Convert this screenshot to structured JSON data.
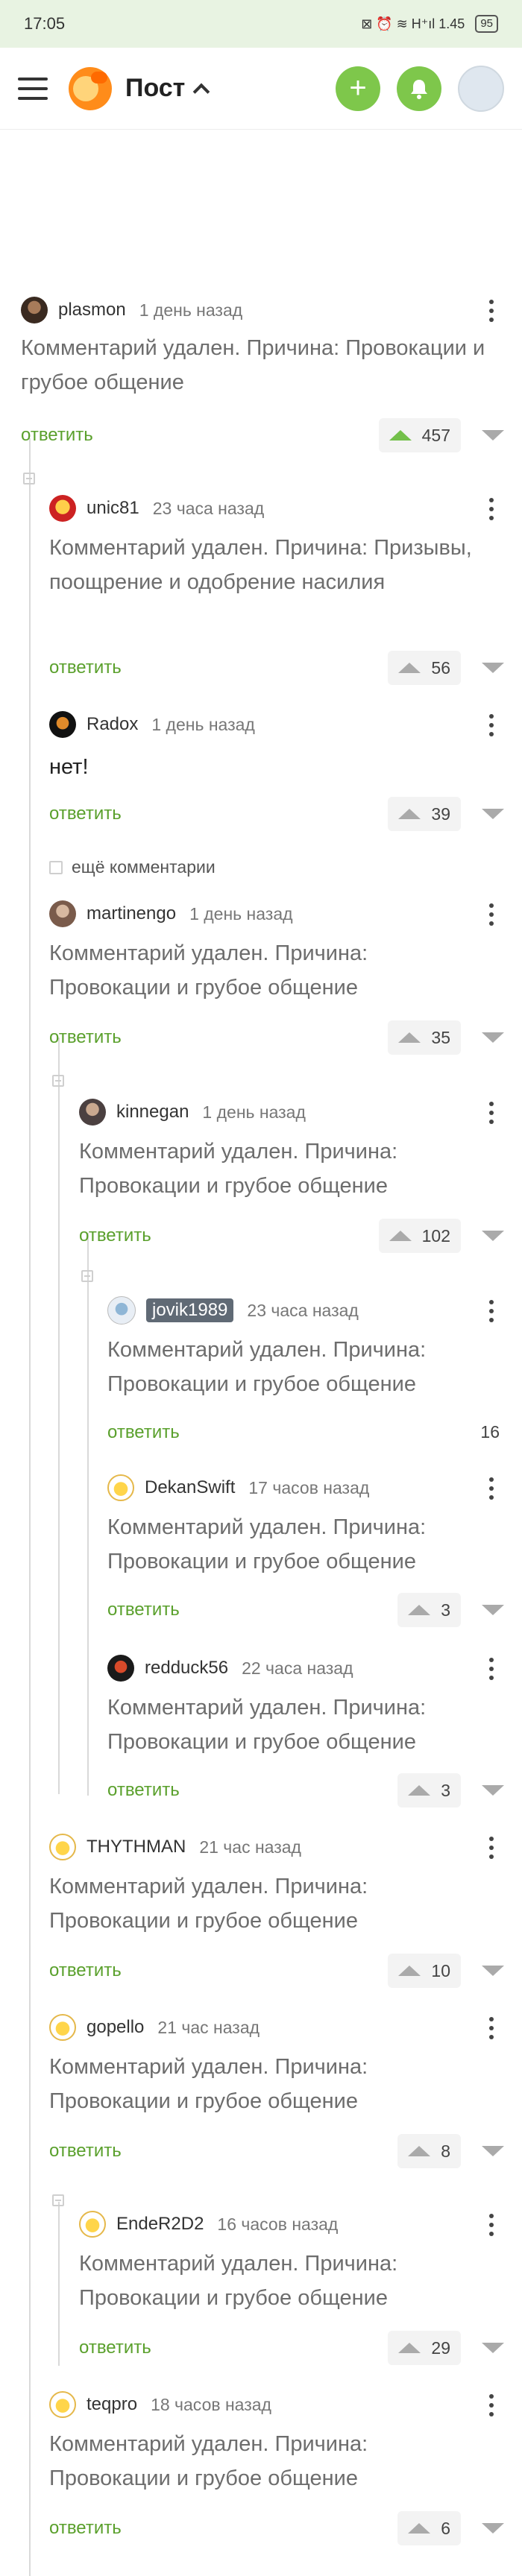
{
  "status": {
    "time": "17:05",
    "icons": "⊠ ⏰ ≋ H⁺ıl 1.45",
    "battery": "95"
  },
  "header": {
    "title": "Пост"
  },
  "comments": [
    {
      "user": "plasmon",
      "when": "1 день назад",
      "text": "Комментарий удален. Причина: Провокации и грубое общение",
      "reply": "ответить",
      "votes": "457"
    },
    {
      "user": "unic81",
      "when": "23 часа назад",
      "text": "Комментарий удален. Причина: Призывы, поощрение и одобрение насилия",
      "reply": "ответить",
      "votes": "56"
    },
    {
      "user": "Radox",
      "when": "1 день назад",
      "text": "нет!",
      "reply": "ответить",
      "votes": "39"
    },
    {
      "user": "martinengo",
      "when": "1 день назад",
      "text": "Комментарий удален. Причина: Провокации и грубое общение",
      "reply": "ответить",
      "votes": "35"
    },
    {
      "user": "kinnegan",
      "when": "1 день назад",
      "text": "Комментарий удален. Причина: Провокации и грубое общение",
      "reply": "ответить",
      "votes": "102"
    },
    {
      "user": "jovik1989",
      "when": "23 часа назад",
      "text": "Комментарий удален. Причина: Провокации и грубое общение",
      "reply": "ответить",
      "votes": "16"
    },
    {
      "user": "DekanSwift",
      "when": "17 часов назад",
      "text": "Комментарий удален. Причина: Провокации и грубое общение",
      "reply": "ответить",
      "votes": "3"
    },
    {
      "user": "redduck56",
      "when": "22 часа назад",
      "text": "Комментарий удален. Причина: Провокации и грубое общение",
      "reply": "ответить",
      "votes": "3"
    },
    {
      "user": "THYTHMAN",
      "when": "21 час назад",
      "text": "Комментарий удален. Причина: Провокации и грубое общение",
      "reply": "ответить",
      "votes": "10"
    },
    {
      "user": "gopello",
      "when": "21 час назад",
      "text": "Комментарий удален. Причина: Провокации и грубое общение",
      "reply": "ответить",
      "votes": "8"
    },
    {
      "user": "EndeR2D2",
      "when": "16 часов назад",
      "text": "Комментарий удален. Причина: Провокации и грубое общение",
      "reply": "ответить",
      "votes": "29"
    },
    {
      "user": "teqpro",
      "when": "18 часов назад",
      "text": "Комментарий удален. Причина: Провокации и грубое общение",
      "reply": "ответить",
      "votes": "6"
    }
  ],
  "more_comments": "ещё комментарии"
}
